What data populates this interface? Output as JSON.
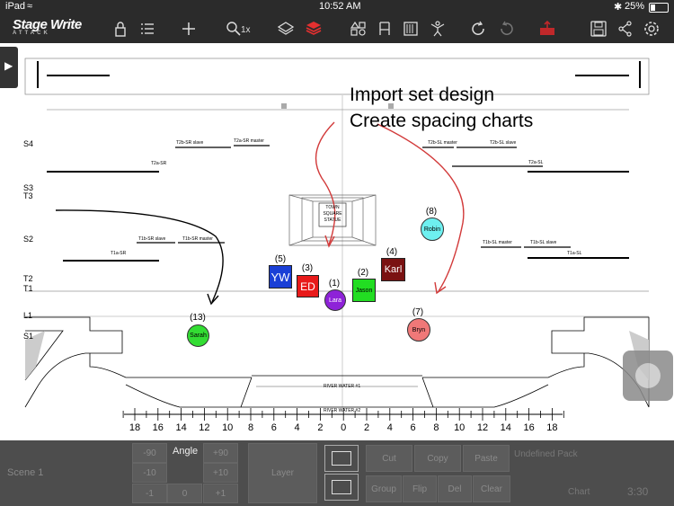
{
  "status": {
    "device": "iPad",
    "time": "10:52 AM",
    "battery": "25%"
  },
  "app": {
    "logo": "Stage Write",
    "logo_sub": "ATTACK",
    "zoom_label": "1x"
  },
  "annotations": [
    "Import set design",
    "Create spacing charts"
  ],
  "stage_labels": {
    "S4": "S4",
    "S3": "S3",
    "T3": "T3",
    "S2": "S2",
    "T2": "T2",
    "T1": "T1",
    "L1": "L1",
    "S1": "S1"
  },
  "set_labels": {
    "t2b_sr_slave": "T2b-SR slave",
    "t2a_sr_master": "T2a-SR master",
    "t2a_sr": "T2a-SR",
    "t2b_sl_master": "T2b-SL master",
    "t2b_sl_slave": "T2b-SL slave",
    "t2a_sl": "T2a-SL",
    "t1b_sr_slave": "T1b-SR slave",
    "t1b_sr_master": "T1b-SR master",
    "t1a_sr": "T1a-SR",
    "t1b_sl_master": "T1b-SL master",
    "t1b_sl_slave": "T1b-SL slave",
    "t1a_sl": "T1a-SL",
    "statue": "TOWN SQUARE STATUE",
    "river1": "RIVER WATER #1",
    "river2": "RIVER WATER #2"
  },
  "performers": [
    {
      "num": "(5)",
      "name": "YW",
      "color": "#1a3fd6",
      "shape": "square"
    },
    {
      "num": "(3)",
      "name": "ED",
      "color": "#e81a1a",
      "shape": "square"
    },
    {
      "num": "(1)",
      "name": "Lara",
      "color": "#8e22d8",
      "shape": "circle"
    },
    {
      "num": "(2)",
      "name": "Jason",
      "color": "#22dd22",
      "shape": "square"
    },
    {
      "num": "(4)",
      "name": "Karl",
      "color": "#7a1212",
      "shape": "square"
    },
    {
      "num": "(8)",
      "name": "Robin",
      "color": "#6ef0f0",
      "shape": "circle"
    },
    {
      "num": "(13)",
      "name": "Sarah",
      "color": "#33dd33",
      "shape": "circle"
    },
    {
      "num": "(7)",
      "name": "Bryn",
      "color": "#f07878",
      "shape": "circle"
    }
  ],
  "ruler": [
    "18",
    "16",
    "14",
    "12",
    "10",
    "8",
    "6",
    "4",
    "2",
    "0",
    "2",
    "4",
    "6",
    "8",
    "10",
    "12",
    "14",
    "16",
    "18"
  ],
  "bottom": {
    "scene": "Scene 1",
    "angle": "Angle",
    "nudge": [
      "-90",
      "+90",
      "-10",
      "+10",
      "-1",
      "0",
      "+1"
    ],
    "layer": "Layer",
    "actions": [
      "Cut",
      "Copy",
      "Paste",
      "Group",
      "Flip",
      "Del",
      "Clear"
    ],
    "right1": "Undefined Pack",
    "right2": "Chart",
    "time": "3:30"
  }
}
